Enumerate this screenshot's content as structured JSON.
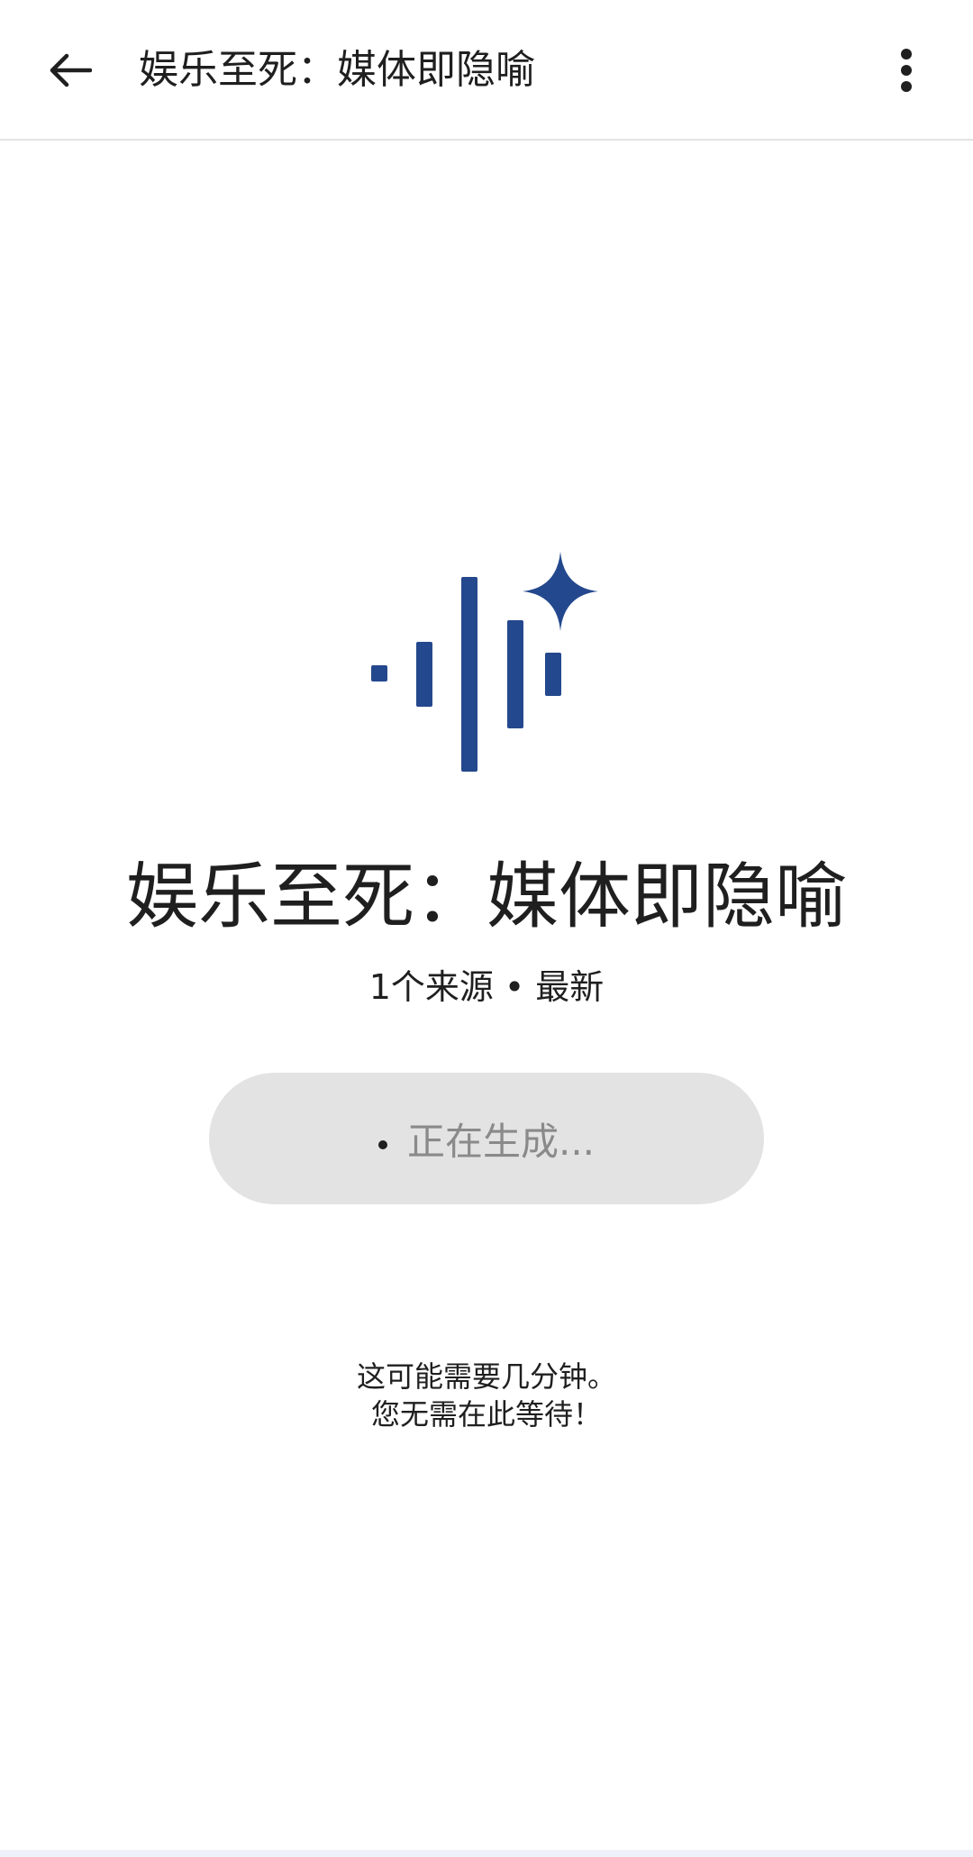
{
  "app_bar": {
    "title": "娱乐至死：媒体即隐喻",
    "back_icon": "arrow-left-icon",
    "more_icon": "more-vert-icon"
  },
  "hero": {
    "icon": "audio-sparkle-icon",
    "color": "#24488d"
  },
  "main": {
    "title": "娱乐至死：媒体即隐喻",
    "source_count": "1个来源",
    "separator": "•",
    "status_tag": "最新",
    "generate_label": "正在生成...",
    "info_line1": "这可能需要几分钟。",
    "info_line2": "您无需在此等待！"
  },
  "colors": {
    "accent": "#24488d",
    "pill_bg": "#e3e3e3",
    "pill_text": "#8a8a8a"
  }
}
